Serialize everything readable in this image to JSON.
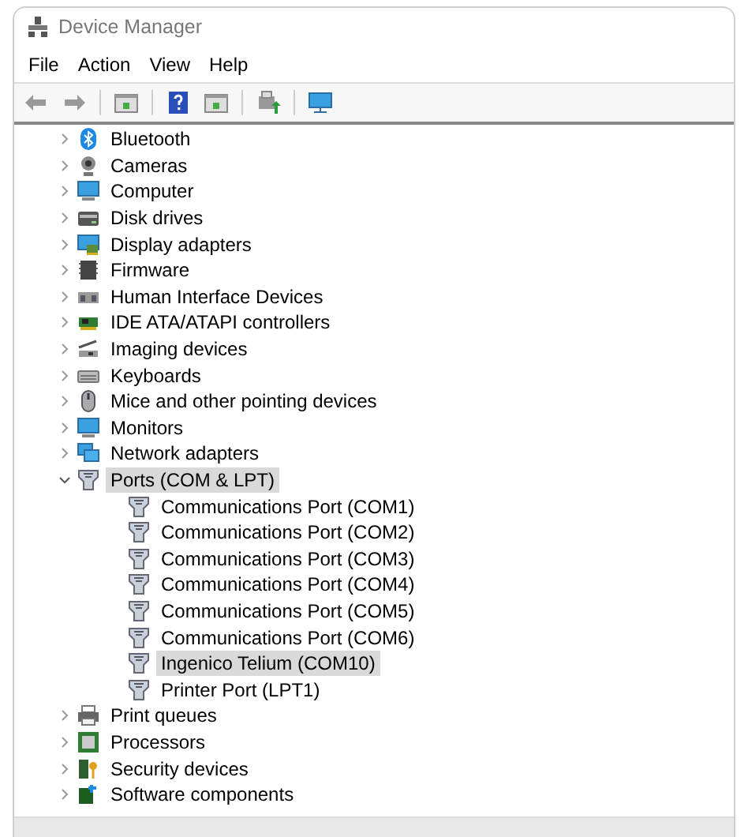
{
  "window": {
    "title": "Device Manager"
  },
  "menu": [
    "File",
    "Action",
    "View",
    "Help"
  ],
  "tree": [
    {
      "label": "Bluetooth",
      "kind": "bluetooth",
      "expanded": false,
      "selected": false
    },
    {
      "label": "Cameras",
      "kind": "camera",
      "expanded": false,
      "selected": false
    },
    {
      "label": "Computer",
      "kind": "monitor",
      "expanded": false,
      "selected": false
    },
    {
      "label": "Disk drives",
      "kind": "disk",
      "expanded": false,
      "selected": false
    },
    {
      "label": "Display adapters",
      "kind": "display",
      "expanded": false,
      "selected": false
    },
    {
      "label": "Firmware",
      "kind": "chip",
      "expanded": false,
      "selected": false
    },
    {
      "label": "Human Interface Devices",
      "kind": "hid",
      "expanded": false,
      "selected": false
    },
    {
      "label": "IDE ATA/ATAPI controllers",
      "kind": "card",
      "expanded": false,
      "selected": false
    },
    {
      "label": "Imaging devices",
      "kind": "scanner",
      "expanded": false,
      "selected": false
    },
    {
      "label": "Keyboards",
      "kind": "keyboard",
      "expanded": false,
      "selected": false
    },
    {
      "label": "Mice and other pointing devices",
      "kind": "mouse",
      "expanded": false,
      "selected": false
    },
    {
      "label": "Monitors",
      "kind": "monitor",
      "expanded": false,
      "selected": false
    },
    {
      "label": "Network adapters",
      "kind": "network",
      "expanded": false,
      "selected": false
    },
    {
      "label": "Ports (COM & LPT)",
      "kind": "port",
      "expanded": true,
      "selected": true,
      "children": [
        {
          "label": "Communications Port (COM1)",
          "kind": "port",
          "selected": false
        },
        {
          "label": "Communications Port (COM2)",
          "kind": "port",
          "selected": false
        },
        {
          "label": "Communications Port (COM3)",
          "kind": "port",
          "selected": false
        },
        {
          "label": "Communications Port (COM4)",
          "kind": "port",
          "selected": false
        },
        {
          "label": "Communications Port (COM5)",
          "kind": "port",
          "selected": false
        },
        {
          "label": "Communications Port (COM6)",
          "kind": "port",
          "selected": false
        },
        {
          "label": "Ingenico Telium (COM10)",
          "kind": "port",
          "selected": true
        },
        {
          "label": "Printer Port (LPT1)",
          "kind": "port",
          "selected": false
        }
      ]
    },
    {
      "label": "Print queues",
      "kind": "printer",
      "expanded": false,
      "selected": false
    },
    {
      "label": "Processors",
      "kind": "cpu",
      "expanded": false,
      "selected": false
    },
    {
      "label": "Security devices",
      "kind": "security",
      "expanded": false,
      "selected": false
    },
    {
      "label": "Software components",
      "kind": "software",
      "expanded": false,
      "selected": false
    }
  ]
}
